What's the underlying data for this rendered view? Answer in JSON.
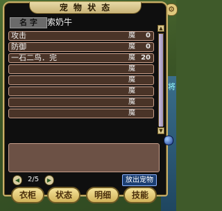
{
  "window": {
    "title": "宠 物 状 态"
  },
  "pet": {
    "name_label": "名 字",
    "name": "索奶牛"
  },
  "skills": [
    {
      "name": "攻击",
      "cost_label": "魔",
      "cost": "0"
    },
    {
      "name": "防御",
      "cost_label": "魔",
      "cost": "0"
    },
    {
      "name": "一石二鸟．完",
      "cost_label": "魔",
      "cost": "20"
    },
    {
      "name": "",
      "cost_label": "魔",
      "cost": ""
    },
    {
      "name": "",
      "cost_label": "魔",
      "cost": ""
    },
    {
      "name": "",
      "cost_label": "魔",
      "cost": ""
    },
    {
      "name": "",
      "cost_label": "魔",
      "cost": ""
    },
    {
      "name": "",
      "cost_label": "魔",
      "cost": ""
    }
  ],
  "pager": {
    "text": "2/5",
    "prev": "◀",
    "next": "▶"
  },
  "actions": {
    "release_label": "放出宠物"
  },
  "tabs": [
    {
      "label": "衣柜"
    },
    {
      "label": "状态"
    },
    {
      "label": "明细"
    },
    {
      "label": "技能"
    }
  ],
  "side": {
    "map_tag": "将"
  },
  "colors": {
    "frame": "#c9b06a",
    "row_bg": "#4a3428",
    "row_border": "#c9a08c",
    "release_bg": "#1c3f72"
  }
}
